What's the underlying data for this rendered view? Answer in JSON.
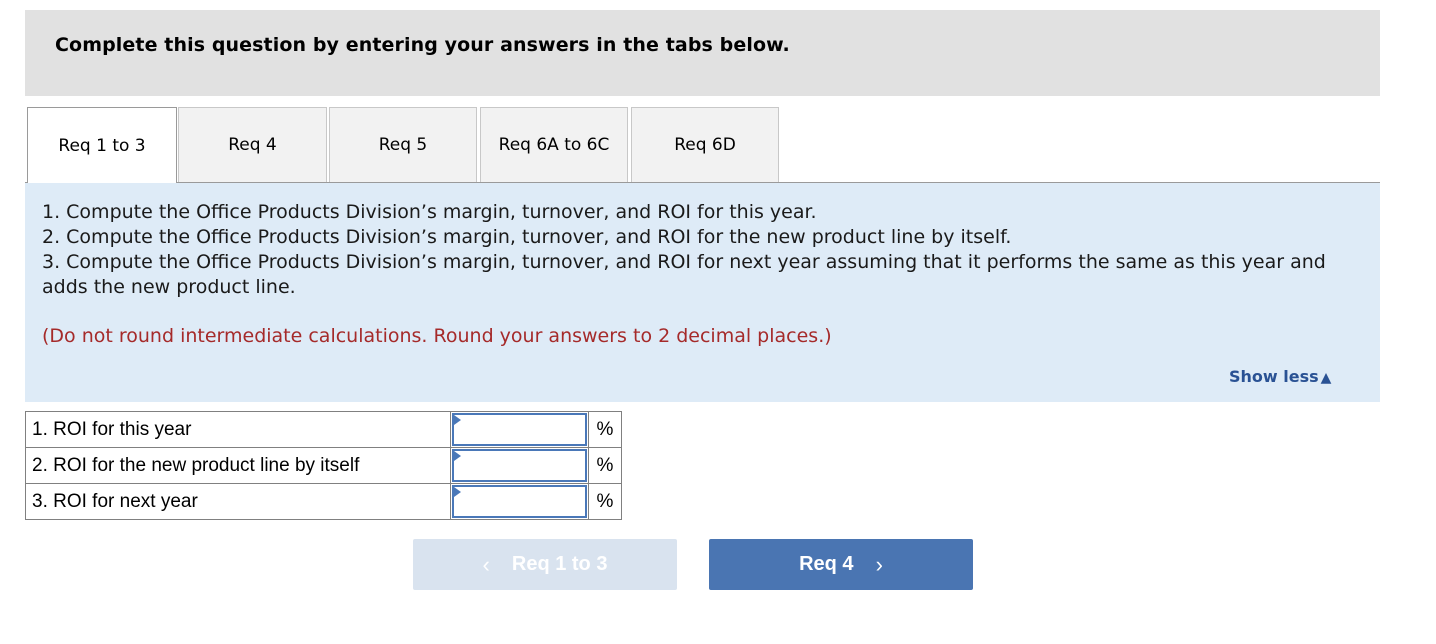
{
  "header": {
    "title": "Complete this question by entering your answers in the tabs below."
  },
  "tabs": [
    {
      "label": "Req 1 to 3",
      "active": true
    },
    {
      "label": "Req 4",
      "active": false
    },
    {
      "label": "Req 5",
      "active": false
    },
    {
      "label": "Req 6A to 6C",
      "active": false
    },
    {
      "label": "Req 6D",
      "active": false
    }
  ],
  "instructions": {
    "items": [
      "1. Compute the Office Products Division’s margin, turnover, and ROI for this year.",
      "2. Compute the Office Products Division’s margin, turnover, and ROI for the new product line by itself.",
      "3. Compute the Office Products Division’s margin, turnover, and ROI for next year assuming that it performs the same as this year and adds the new product line."
    ],
    "note": "(Do not round intermediate calculations. Round your answers to 2 decimal places.)",
    "note_color": "#a52a2a",
    "show_less_label": "Show less",
    "show_less_icon": "▲"
  },
  "answers": {
    "rows": [
      {
        "label": "1. ROI for this year",
        "value": "",
        "unit": "%"
      },
      {
        "label": "2. ROI for the new product line by itself",
        "value": "",
        "unit": "%"
      },
      {
        "label": "3. ROI for next year",
        "value": "",
        "unit": "%"
      }
    ]
  },
  "navigation": {
    "prev": {
      "label": "Req 1 to 3",
      "icon": "‹",
      "enabled": false
    },
    "next": {
      "label": "Req 4",
      "icon": "›",
      "enabled": true
    }
  },
  "colors": {
    "accent": "#4a75b2",
    "info_background": "#deebf7",
    "header_background": "#e1e1e1",
    "link": "#2a5294"
  }
}
